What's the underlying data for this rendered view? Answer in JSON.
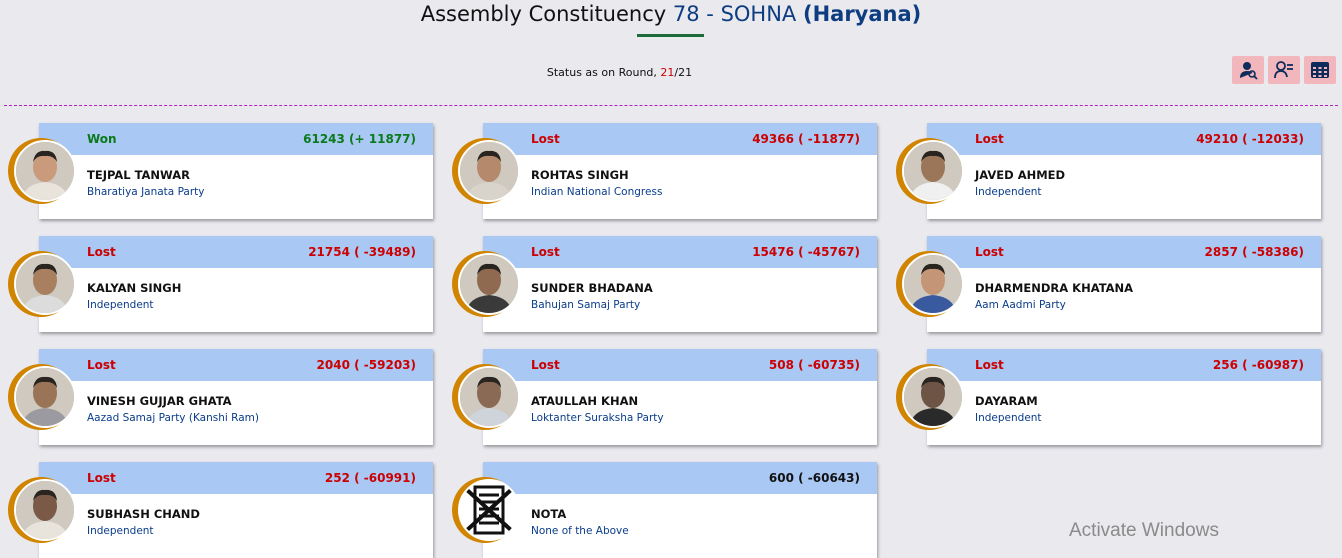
{
  "header": {
    "title_prefix": "Assembly Constituency",
    "number": "78",
    "separator": "-",
    "constituency": "SOHNA",
    "state": "(Haryana)"
  },
  "status": {
    "label": "Status as on Round,",
    "current_round": "21",
    "slash": "/",
    "total_rounds": "21"
  },
  "toolbar": {
    "icons": [
      "candidate-search-icon",
      "candidate-list-icon",
      "table-view-icon"
    ]
  },
  "colors": {
    "won": "#0a7a1a",
    "lost": "#c00000",
    "card_header": "#a9c8f4",
    "avatar_ring": "#d08400"
  },
  "candidates": [
    {
      "status": "Won",
      "votes": "61243 (+ 11877)",
      "name": "TEJPAL TANWAR",
      "party": "Bharatiya Janata Party"
    },
    {
      "status": "Lost",
      "votes": "49366 ( -11877)",
      "name": "ROHTAS SINGH",
      "party": "Indian National Congress"
    },
    {
      "status": "Lost",
      "votes": "49210 ( -12033)",
      "name": "JAVED AHMED",
      "party": "Independent"
    },
    {
      "status": "Lost",
      "votes": "21754 ( -39489)",
      "name": "KALYAN SINGH",
      "party": "Independent"
    },
    {
      "status": "Lost",
      "votes": "15476 ( -45767)",
      "name": "SUNDER BHADANA",
      "party": "Bahujan Samaj Party"
    },
    {
      "status": "Lost",
      "votes": "2857 ( -58386)",
      "name": "DHARMENDRA KHATANA",
      "party": "Aam Aadmi Party"
    },
    {
      "status": "Lost",
      "votes": "2040 ( -59203)",
      "name": "VINESH GUJJAR GHATA",
      "party": "Aazad Samaj Party (Kanshi Ram)"
    },
    {
      "status": "Lost",
      "votes": "508 ( -60735)",
      "name": "ATAULLAH KHAN",
      "party": "Loktanter Suraksha Party"
    },
    {
      "status": "Lost",
      "votes": "256 ( -60987)",
      "name": "DAYARAM",
      "party": "Independent"
    },
    {
      "status": "Lost",
      "votes": "252 ( -60991)",
      "name": "SUBHASH CHAND",
      "party": "Independent"
    },
    {
      "status": "",
      "votes": "600 ( -60643)",
      "name": "NOTA",
      "party": "None of the Above"
    }
  ],
  "watermark": "Activate Windows"
}
